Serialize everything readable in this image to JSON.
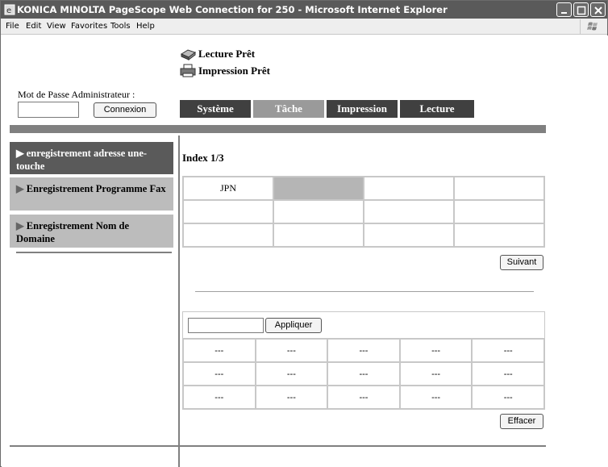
{
  "window": {
    "title": "KONICA MINOLTA PageScope Web Connection for 250 - Microsoft Internet Explorer"
  },
  "menu": [
    "File",
    "Edit",
    "View",
    "Favorites",
    "Tools",
    "Help"
  ],
  "status": {
    "scan": "Lecture Prêt",
    "print": "Impression Prêt"
  },
  "login": {
    "label": "Mot de Passe Administrateur :",
    "password_value": "",
    "button": "Connexion"
  },
  "tabs": [
    {
      "label": "Système",
      "color": "#404040"
    },
    {
      "label": "Tâche",
      "color": "#9a9a9a"
    },
    {
      "label": "Impression",
      "color": "#404040"
    },
    {
      "label": "Lecture",
      "color": "#404040"
    }
  ],
  "sidebar": {
    "items": [
      {
        "label": "enregistrement adresse une-touche",
        "active": true
      },
      {
        "label": "Enregistrement Programme Fax",
        "active": false
      },
      {
        "label": "Enregistrement Nom de Domaine",
        "active": false
      }
    ]
  },
  "main": {
    "index_title": "Index 1/3",
    "index_grid": [
      [
        "JPN",
        "",
        "",
        ""
      ],
      [
        "",
        "",
        "",
        ""
      ],
      [
        "",
        "",
        "",
        ""
      ]
    ],
    "next_button": "Suivant",
    "apply_input": "",
    "apply_button": "Appliquer",
    "entry_grid": [
      [
        "---",
        "---",
        "---",
        "---",
        "---"
      ],
      [
        "---",
        "---",
        "---",
        "---",
        "---"
      ],
      [
        "---",
        "---",
        "---",
        "---",
        "---"
      ]
    ],
    "clear_button": "Effacer"
  },
  "colors": {
    "active_sidebar": "#5a5a5a",
    "inactive_sidebar": "#bcbcbc",
    "selected_cell": "#b5b5b5"
  }
}
